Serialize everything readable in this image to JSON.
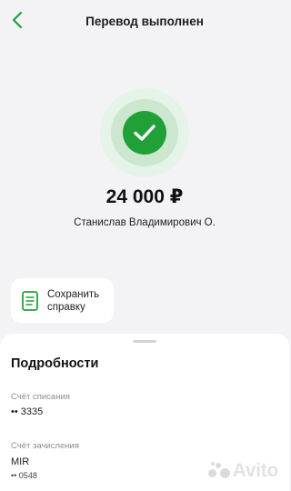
{
  "header": {
    "title": "Перевод выполнен",
    "back_icon": "chevron-left-icon"
  },
  "status": {
    "icon": "checkmark-icon",
    "color": "#21a038"
  },
  "amount": "24 000 ₽",
  "recipient": "Станислав Владимирович О.",
  "save_receipt": {
    "label": "Сохранить справку",
    "icon": "document-icon"
  },
  "details": {
    "title": "Подробности",
    "debit_account": {
      "label": "Счёт списания",
      "value": "•• 3335"
    },
    "credit_account": {
      "label": "Счёт зачисления",
      "value": "MIR",
      "number": "•• 0548"
    }
  },
  "watermark": {
    "text": "Avito"
  }
}
